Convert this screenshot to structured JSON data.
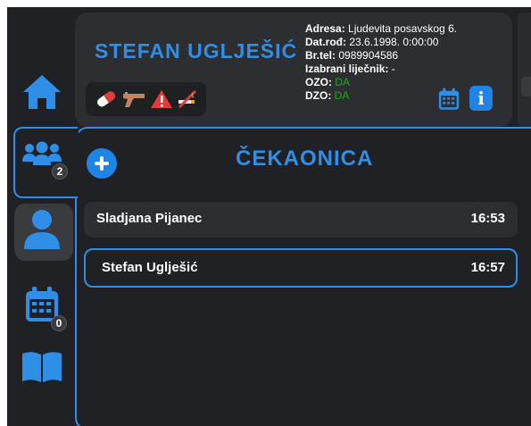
{
  "patient": {
    "name": "STEFAN UGLJEŠIĆ",
    "flag_icons": [
      "pill-icon",
      "gun-icon",
      "warning-icon",
      "no-smoking-icon"
    ],
    "info": {
      "address_label": "Adresa:",
      "address_value": "Ljudevita posavskog 6.",
      "dob_label": "Dat.rođ:",
      "dob_value": "23.6.1998. 0:00:00",
      "phone_label": "Br.tel:",
      "phone_value": "0989904586",
      "doctor_label": "Izabrani liječnik:",
      "doctor_value": "-",
      "ozo_label": "OZO:",
      "ozo_value": "DA",
      "dzo_label": "DZO:",
      "dzo_value": "DA"
    },
    "info_button_label": "i"
  },
  "nav": {
    "waiting_badge": "2",
    "calendar_badge": "0"
  },
  "waiting_room": {
    "title": "ČEKAONICA",
    "rows": [
      {
        "name": "Sladjana Pijanec",
        "time": "16:53"
      },
      {
        "name": "Stefan Uglješić",
        "time": "16:57"
      }
    ]
  },
  "colors": {
    "accent": "#2f8fe6",
    "background": "#202124",
    "card": "#2d2e31",
    "status_green": "#19a91c"
  }
}
